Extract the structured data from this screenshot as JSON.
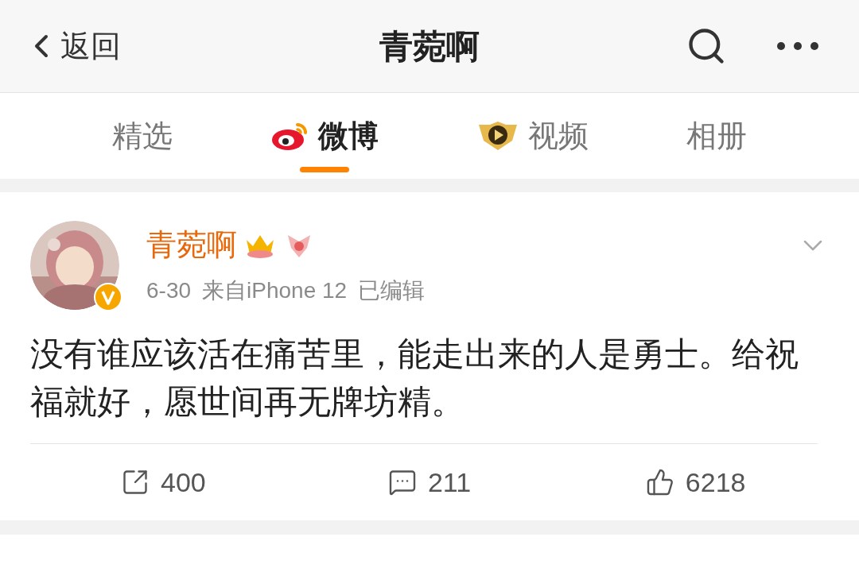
{
  "header": {
    "back": "返回",
    "title": "青菀啊"
  },
  "tabs": [
    {
      "label": "精选",
      "selected": false,
      "kind": "plain"
    },
    {
      "label": "微博",
      "selected": true,
      "kind": "weibo"
    },
    {
      "label": "视频",
      "selected": false,
      "kind": "video"
    },
    {
      "label": "相册",
      "selected": false,
      "kind": "plain"
    }
  ],
  "post": {
    "author": "青菀啊",
    "verified": true,
    "time": "6-30",
    "source": "来自iPhone 12",
    "edited": "已编辑",
    "text": "没有谁应该活在痛苦里，能走出来的人是勇士。给祝福就好，愿世间再无牌坊精。",
    "actions": [
      {
        "kind": "repost",
        "count": "400"
      },
      {
        "kind": "comment",
        "count": "211"
      },
      {
        "kind": "like",
        "count": "6218"
      }
    ]
  }
}
